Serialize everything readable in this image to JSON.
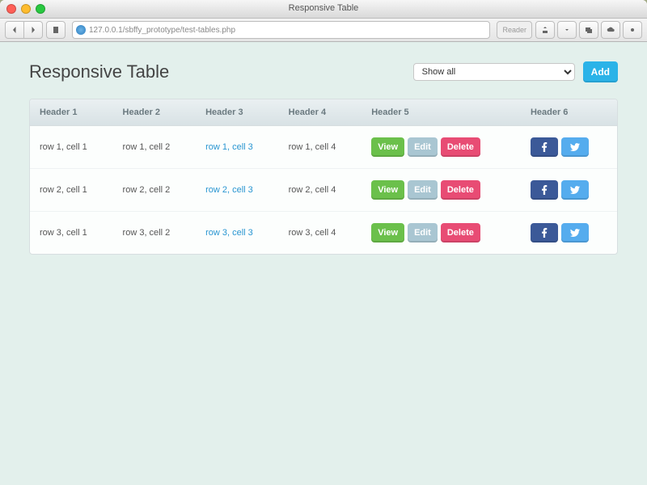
{
  "window": {
    "title": "Responsive Table",
    "url": "127.0.0.1/sbffy_prototype/test-tables.php",
    "reader_label": "Reader"
  },
  "page": {
    "title": "Responsive Table",
    "filter_selected": "Show all",
    "add_label": "Add"
  },
  "table": {
    "headers": [
      "Header 1",
      "Header 2",
      "Header 3",
      "Header 4",
      "Header 5",
      "Header 6"
    ],
    "actions": {
      "view": "View",
      "edit": "Edit",
      "delete": "Delete"
    },
    "rows": [
      {
        "c1": "row 1, cell 1",
        "c2": "row 1, cell 2",
        "c3": "row 1, cell 3",
        "c4": "row 1, cell 4"
      },
      {
        "c1": "row 2, cell 1",
        "c2": "row 2, cell 2",
        "c3": "row 2, cell 3",
        "c4": "row 2, cell 4"
      },
      {
        "c1": "row 3, cell 1",
        "c2": "row 3, cell 2",
        "c3": "row 3, cell 3",
        "c4": "row 3, cell 4"
      }
    ]
  }
}
